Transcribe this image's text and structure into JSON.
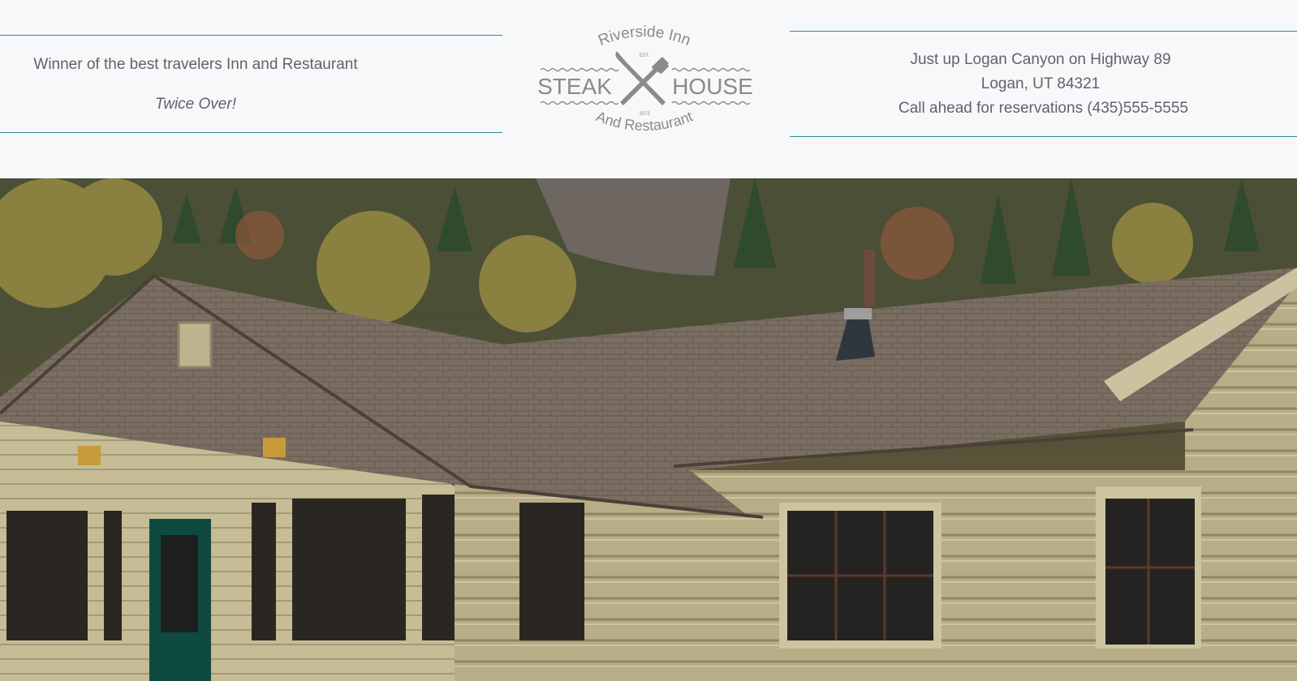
{
  "header": {
    "award": {
      "line1": "Winner of the best travelers Inn and Restaurant",
      "line2": "Twice Over!"
    },
    "logo": {
      "top_arc": "Riverside Inn",
      "est_label": "EST.",
      "year": "1972",
      "left_word": "STEAK",
      "right_word": "HOUSE",
      "bottom_arc": "And Restaurant",
      "icon": "crossed-knife-fork-icon"
    },
    "contact": {
      "line1": "Just up Logan Canyon on Highway 89",
      "line2": "Logan, UT 84321",
      "line3": "Call ahead for reservations (435)555-5555"
    }
  },
  "hero": {
    "alt": "Log cabin restaurant building with shingled roof in a forested canyon"
  },
  "colors": {
    "rule": "#2a8c93",
    "text": "#5f6368",
    "logo": "#8a8a8a",
    "background": "#f7f8fa"
  }
}
